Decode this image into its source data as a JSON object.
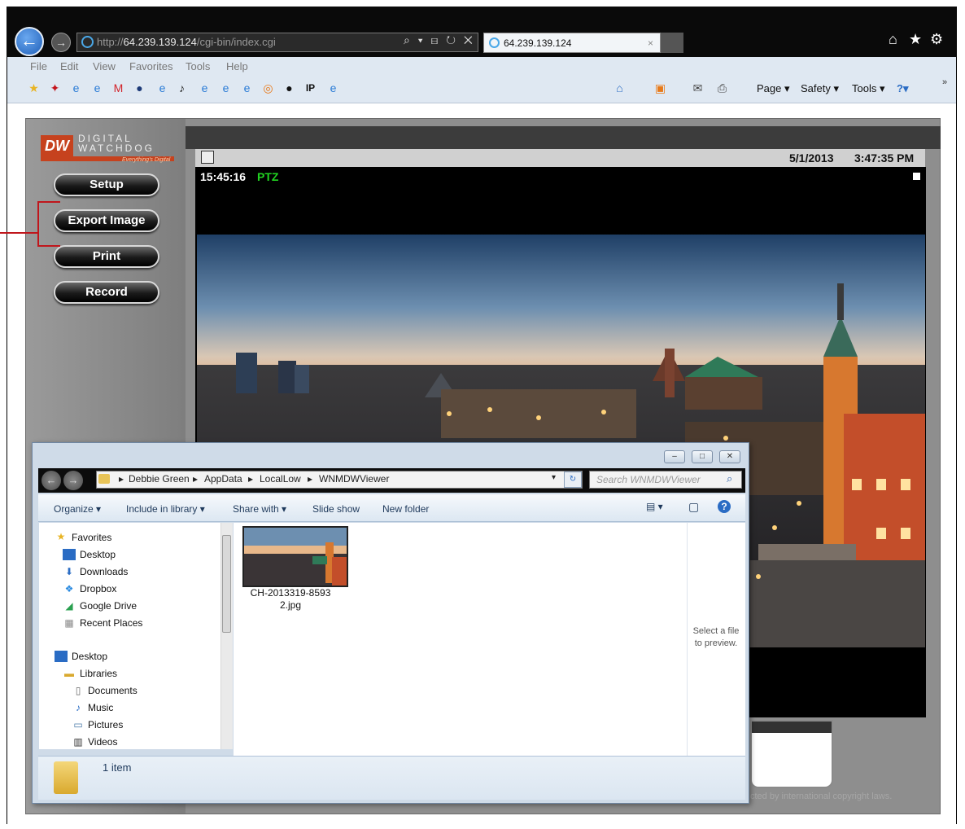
{
  "browser": {
    "address": {
      "protocol": "http://",
      "host": "64.239.139.124",
      "path": "/cgi-bin/index.cgi",
      "tools": "⌕ ▾ ⊟ ↻ ✕"
    },
    "tab": {
      "title": "64.239.139.124",
      "close": "×"
    },
    "window_icons": {
      "home": "⌂",
      "favorites": "★",
      "settings": "⚙"
    },
    "menu": [
      "File",
      "Edit",
      "View",
      "Favorites",
      "Tools",
      "Help"
    ],
    "command_bar": {
      "page": "Page ▾",
      "safety": "Safety ▾",
      "tools": "Tools ▾",
      "help": "?▾",
      "more": "»"
    }
  },
  "dvr": {
    "logo": {
      "brand_line1": "DIGITAL",
      "brand_line2": "WATCHDOG",
      "mark": "DW",
      "tagline": "Everything's Digital"
    },
    "buttons": [
      "Setup",
      "Export Image",
      "Print",
      "Record"
    ],
    "date": "5/1/2013",
    "time": "3:47:35 PM",
    "video": {
      "timestamp": "15:45:16",
      "mode": "PTZ"
    },
    "copyright": "cted by international copyright laws."
  },
  "explorer": {
    "caption_buttons": {
      "minimize": "–",
      "maximize": "□",
      "close": "✕"
    },
    "breadcrumb": [
      "Debbie Green",
      "AppData",
      "LocalLow",
      "WNMDWViewer"
    ],
    "search_placeholder": "Search WNMDWViewer",
    "toolbar": {
      "organize": "Organize ▾",
      "include": "Include in library ▾",
      "share": "Share with ▾",
      "slideshow": "Slide show",
      "new_folder": "New folder"
    },
    "nav": {
      "favorites": "Favorites",
      "desktop": "Desktop",
      "downloads": "Downloads",
      "dropbox": "Dropbox",
      "google_drive": "Google Drive",
      "recent_places": "Recent Places",
      "desktop2": "Desktop",
      "libraries": "Libraries",
      "documents": "Documents",
      "music": "Music",
      "pictures": "Pictures",
      "videos": "Videos"
    },
    "file": {
      "name_line1": "CH-2013319-8593",
      "name_line2": "2.jpg"
    },
    "preview_hint": "Select a file to preview.",
    "status": "1 item"
  }
}
